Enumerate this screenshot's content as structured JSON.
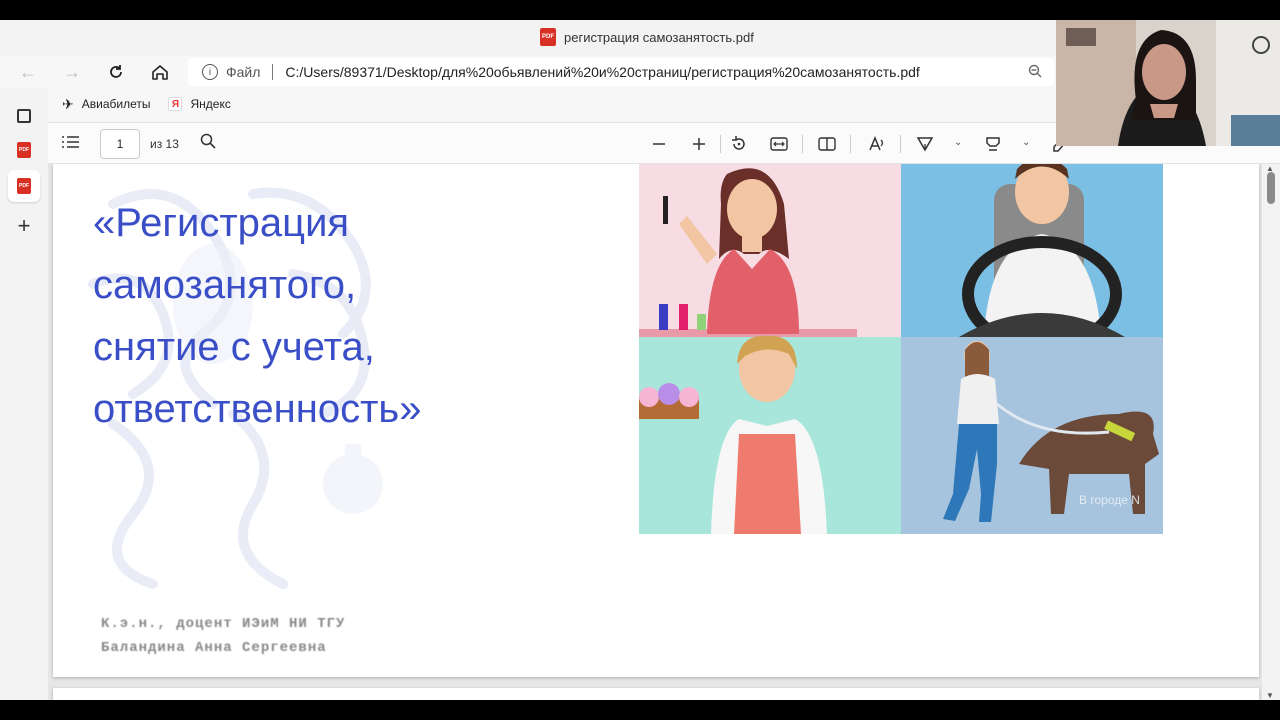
{
  "window": {
    "title": "регистрация самозанятость.pdf",
    "pdf_badge": "PDF"
  },
  "address": {
    "file_label": "Файл",
    "url": "C:/Users/89371/Desktop/для%20обьявлений%20и%20страниц/регистрация%20самозанятость.pdf"
  },
  "bookmarks": [
    {
      "label": "Авиабилеты",
      "icon": "plane-icon"
    },
    {
      "label": "Яндекс",
      "icon": "yandex-icon",
      "glyph": "Я"
    }
  ],
  "pdf_toolbar": {
    "page_current": "1",
    "page_total_label": "из 13"
  },
  "slide": {
    "title_lines": [
      "«Регистрация",
      "самозанятого,",
      "снятие с учета,",
      "ответственность»"
    ],
    "author_lines": [
      "К.э.н., доцент ИЭиМ НИ ТГУ",
      "Баландина Анна Сергеевна"
    ],
    "image_watermark": "В городе N"
  },
  "colors": {
    "title_blue": "#3a4fc7",
    "pdf_red": "#d93025"
  }
}
